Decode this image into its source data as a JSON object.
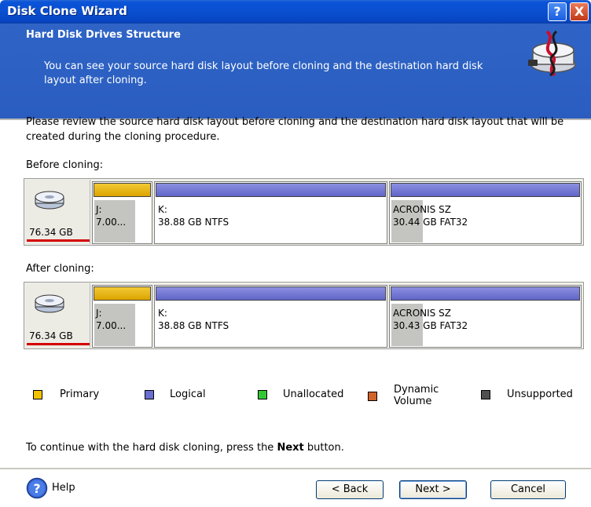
{
  "window": {
    "title": "Disk Clone Wizard",
    "help_glyph": "?",
    "close_glyph": "X"
  },
  "header": {
    "title": "Hard Disk Drives Structure",
    "description": "You can see your source hard disk layout before cloning and the destination hard disk layout after cloning.",
    "icon": "disk-clone-icon"
  },
  "intro": "Please review the source hard disk layout before cloning and the destination hard disk layout that will be created during the cloning procedure.",
  "before": {
    "label": "Before cloning:",
    "disk_size": "76.34 GB",
    "partitions": [
      {
        "type": "primary",
        "name": "J:",
        "info": "7.00..."
      },
      {
        "type": "logical",
        "name": "K:",
        "info": "38.88 GB  NTFS"
      },
      {
        "type": "logical",
        "name": "ACRONIS SZ",
        "info": "30.44 GB  FAT32"
      }
    ]
  },
  "after": {
    "label": "After cloning:",
    "disk_size": "76.34 GB",
    "partitions": [
      {
        "type": "primary",
        "name": "J:",
        "info": "7.00..."
      },
      {
        "type": "logical",
        "name": "K:",
        "info": "38.88 GB  NTFS"
      },
      {
        "type": "logical",
        "name": "ACRONIS SZ",
        "info": "30.43 GB  FAT32"
      }
    ]
  },
  "legend": [
    {
      "label": "Primary",
      "color": "#f2c400"
    },
    {
      "label": "Logical",
      "color": "#6a6ed0"
    },
    {
      "label": "Unallocated",
      "color": "#33c833"
    },
    {
      "label_line1": "Dynamic",
      "label_line2": "Volume",
      "color": "#d2642a"
    },
    {
      "label": "Unsupported",
      "color": "#505050"
    }
  ],
  "continue": {
    "prefix": "To continue with the hard disk cloning, press the ",
    "bold": "Next",
    "suffix": " button."
  },
  "buttons": {
    "help": "Help",
    "back": "< Back",
    "next": "Next >",
    "cancel": "Cancel"
  }
}
